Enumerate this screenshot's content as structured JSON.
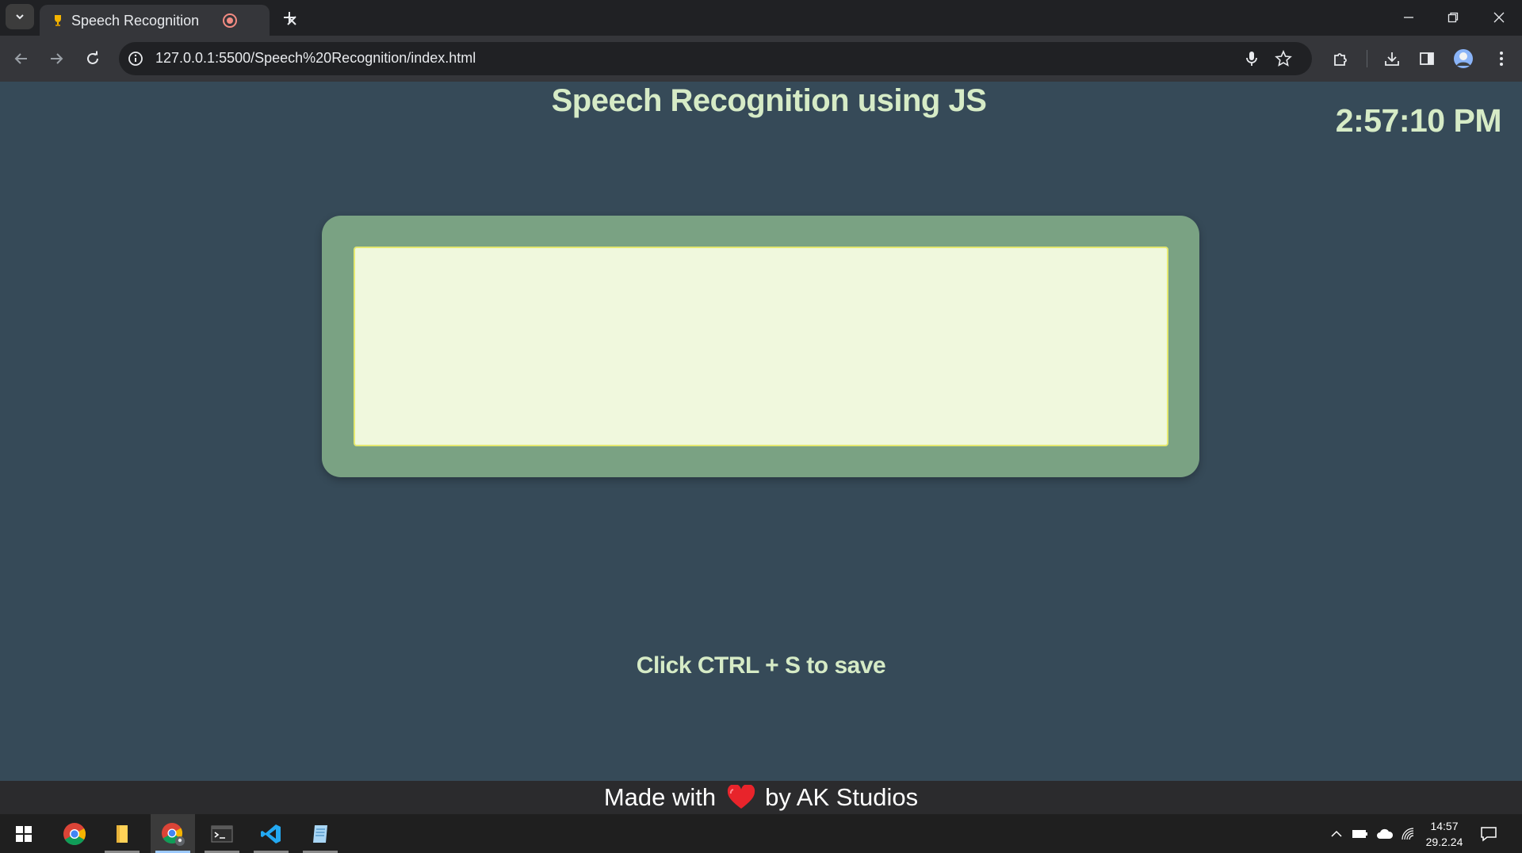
{
  "browser": {
    "tab_title": "Speech Recognition",
    "url": "127.0.0.1:5500/Speech%20Recognition/index.html"
  },
  "page": {
    "title": "Speech Recognition using JS",
    "clock": "2:57:10 PM",
    "transcript": "",
    "hint": "Click CTRL + S to save",
    "footer": {
      "prefix": "Made with",
      "suffix": "by AK Studios"
    }
  },
  "colors": {
    "page_bg": "#364a58",
    "text_accent": "#d6ebc6",
    "card": "#7aa283",
    "textarea_bg": "#f0f8dd",
    "heart": "#e8242b"
  },
  "taskbar": {
    "time": "14:57",
    "date": "29.2.24",
    "apps": [
      "start-icon",
      "chrome-icon",
      "file-explorer-icon",
      "chrome-profile-icon",
      "terminal-icon",
      "vscode-icon",
      "notepad-icon"
    ]
  }
}
